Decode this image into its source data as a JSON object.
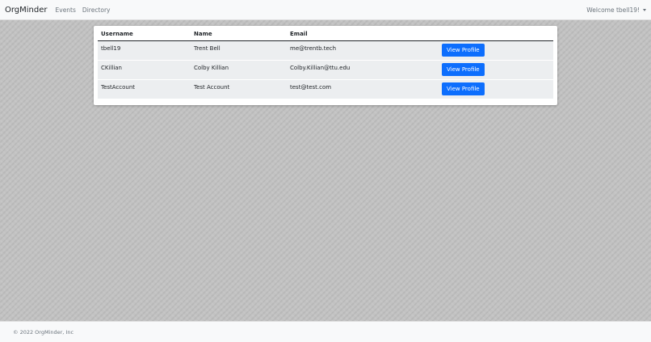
{
  "navbar": {
    "brand": "OrgMinder",
    "links": [
      "Events",
      "Directory"
    ],
    "welcome": "Welcome tbell19!"
  },
  "table": {
    "headers": [
      "Username",
      "Name",
      "Email"
    ],
    "rows": [
      {
        "username": "tbell19",
        "name": "Trent Bell",
        "email": "me@trentb.tech",
        "action": "View Profile"
      },
      {
        "username": "CKillian",
        "name": "Colby Killian",
        "email": "Colby.Killian@ttu.edu",
        "action": "View Profile"
      },
      {
        "username": "TestAccount",
        "name": "Test Account",
        "email": "test@test.com",
        "action": "View Profile"
      }
    ]
  },
  "footer": {
    "text": "© 2022 OrgMinder, Inc"
  },
  "colors": {
    "primary_button": "#0d6efd",
    "navbar_bg": "#f8f9fa",
    "row_bg": "#eceef0"
  }
}
